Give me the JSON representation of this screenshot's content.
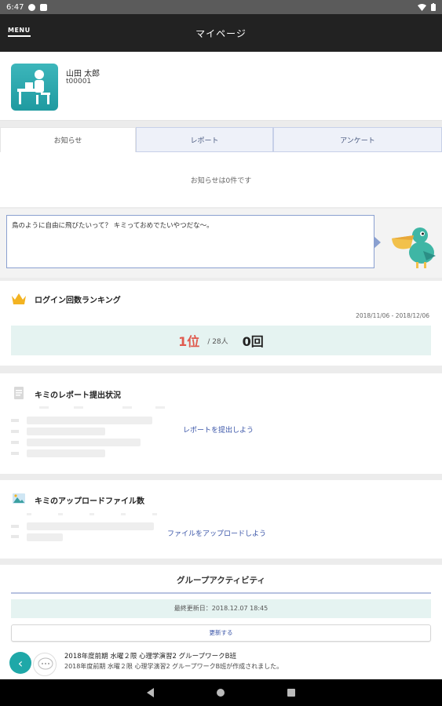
{
  "status_bar": {
    "time": "6:47"
  },
  "app_bar": {
    "menu_label": "MENU",
    "title": "マイページ"
  },
  "profile": {
    "name": "山田 太郎",
    "user_id": "t00001"
  },
  "tabs": [
    {
      "label": "お知らせ",
      "active": true
    },
    {
      "label": "レポート",
      "active": false
    },
    {
      "label": "アンケート",
      "active": false
    }
  ],
  "notice_empty": "お知らせは0件です",
  "bird_message": "鳥のように自由に飛びたいって？ キミっておめでたいやつだな〜。",
  "ranking": {
    "title": "ログイン回数ランキング",
    "date_range": "2018/11/06 - 2018/12/06",
    "position": "1位",
    "total": "/ 28人",
    "count": "0回"
  },
  "report": {
    "title": "キミのレポート提出状況",
    "link": "レポートを提出しよう"
  },
  "upload": {
    "title": "キミのアップロードファイル数",
    "link": "ファイルをアップロードしよう"
  },
  "group": {
    "title": "グループアクティビティ",
    "last_updated": "最終更新日：2018.12.07 18:45",
    "refresh_label": "更新する",
    "activity_title": "2018年度前期 水曜２限 心理学演習2 グループワークB班",
    "activity_desc": "2018年度前期 水曜２限 心理学演習2 グループワークB班が作成されました。"
  },
  "colors": {
    "accent_teal": "#1fa8a8",
    "rank_red": "#e05a4e",
    "link_blue": "#3a55a8"
  },
  "icons": [
    "wifi-icon",
    "battery-icon",
    "crown-icon",
    "report-icon",
    "image-icon",
    "chevron-left-icon"
  ]
}
